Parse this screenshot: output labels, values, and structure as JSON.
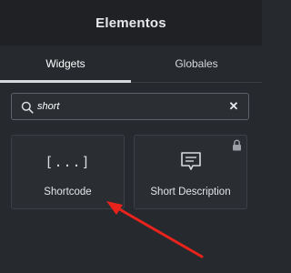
{
  "header": {
    "title": "Elementos"
  },
  "tabs": [
    {
      "label": "Widgets",
      "active": true
    },
    {
      "label": "Globales",
      "active": false
    }
  ],
  "search": {
    "value": "short",
    "icon": "search-icon",
    "clear_icon": "close-icon"
  },
  "widgets": [
    {
      "label": "Shortcode",
      "icon": "shortcode-icon",
      "locked": false
    },
    {
      "label": "Short Description",
      "icon": "short-description-icon",
      "locked": true
    }
  ],
  "annotation": {
    "arrow_color": "#e8231c"
  },
  "colors": {
    "background": "#26292d",
    "header": "#1f2124",
    "card": "#2a2d32"
  }
}
